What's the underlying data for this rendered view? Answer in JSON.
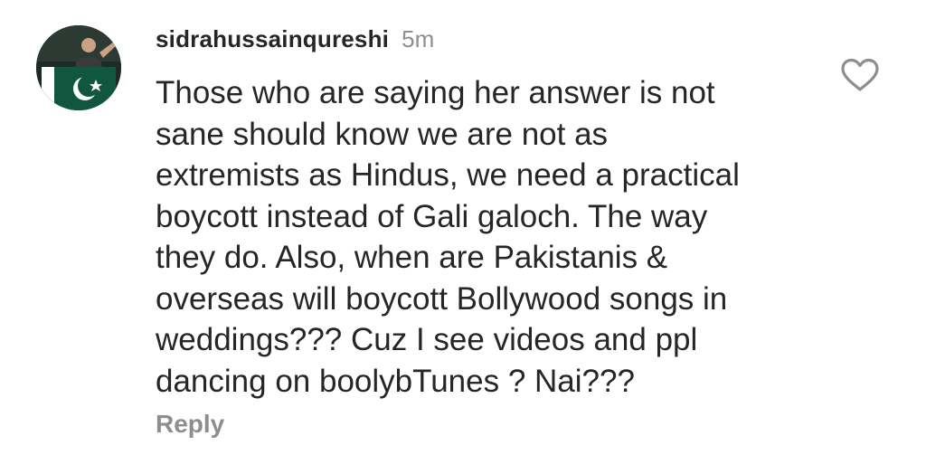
{
  "comment": {
    "username": "sidrahussainqureshi",
    "timestamp": "5m",
    "text_lines": [
      "Those who are saying her answer is not",
      "sane should know we are not as",
      "extremists as Hindus, we need a practical",
      "boycott instead of Gali galoch. The way",
      "they do. Also, when are Pakistanis &",
      "overseas will boycott Bollywood songs in",
      "weddings??? Cuz I see videos and ppl",
      "dancing on boolybTunes ? Nai???"
    ],
    "reply_label": "Reply"
  },
  "icons": {
    "like": "heart-outline-icon",
    "avatar": "profile-photo-pakistan-flag"
  },
  "colors": {
    "text": "#262626",
    "muted": "#8e8e8e",
    "flag_green": "#115740",
    "flag_white": "#ffffff"
  }
}
